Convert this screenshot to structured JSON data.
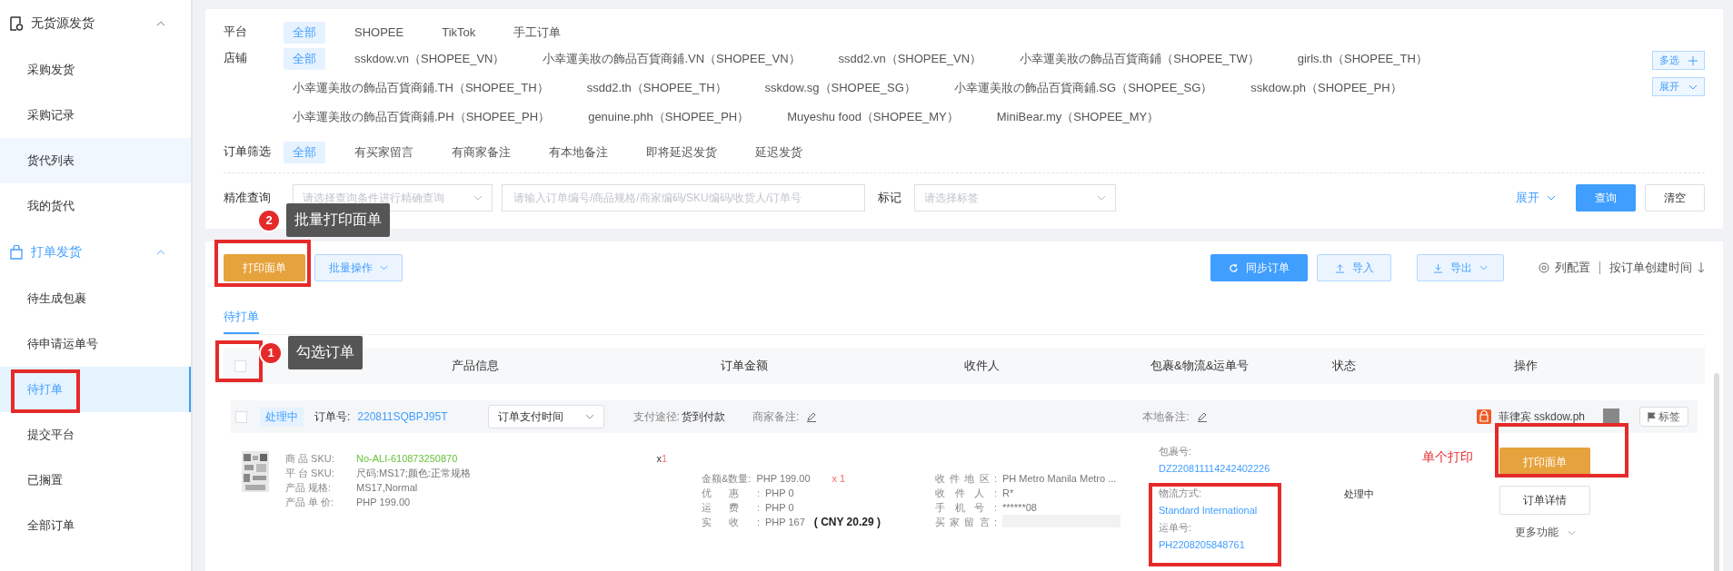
{
  "sidebar": {
    "groups": [
      {
        "label": "无货源发货",
        "kind": "doc",
        "active": false,
        "expanded": true,
        "items": [
          {
            "label": "采购发货",
            "selected": false,
            "hovered": false
          },
          {
            "label": "采购记录",
            "selected": false,
            "hovered": false
          },
          {
            "label": "货代列表",
            "selected": false,
            "hovered": true
          },
          {
            "label": "我的货代",
            "selected": false,
            "hovered": false
          }
        ]
      },
      {
        "label": "打单发货",
        "kind": "bag",
        "active": true,
        "expanded": true,
        "items": [
          {
            "label": "待生成包裹",
            "selected": false,
            "hovered": false
          },
          {
            "label": "待申请运单号",
            "selected": false,
            "hovered": false
          },
          {
            "label": "待打单",
            "selected": true,
            "hovered": false
          },
          {
            "label": "提交平台",
            "selected": false,
            "hovered": false
          },
          {
            "label": "已搁置",
            "selected": false,
            "hovered": false
          },
          {
            "label": "全部订单",
            "selected": false,
            "hovered": false
          }
        ]
      }
    ]
  },
  "filters": {
    "platform": {
      "label": "平台",
      "options": [
        {
          "label": "全部",
          "selected": true
        },
        {
          "label": "SHOPEE",
          "selected": false
        },
        {
          "label": "TikTok",
          "selected": false
        },
        {
          "label": "手工订单",
          "selected": false
        }
      ]
    },
    "store": {
      "label": "店铺",
      "rows": [
        {
          "options": [
            {
              "label": "全部",
              "selected": true
            },
            {
              "label": "sskdow.vn（SHOPEE_VN）",
              "selected": false
            },
            {
              "label": "小幸運美妝の飾品百貨商鋪.VN（SHOPEE_VN）",
              "selected": false
            },
            {
              "label": "ssdd2.vn（SHOPEE_VN）",
              "selected": false
            },
            {
              "label": "小幸運美妝の飾品百貨商鋪（SHOPEE_TW）",
              "selected": false
            },
            {
              "label": "girls.th（SHOPEE_TH）",
              "selected": false
            }
          ]
        },
        {
          "options": [
            {
              "label": "小幸運美妝の飾品百貨商鋪.TH（SHOPEE_TH）",
              "selected": false
            },
            {
              "label": "ssdd2.th（SHOPEE_TH）",
              "selected": false
            },
            {
              "label": "sskdow.sg（SHOPEE_SG）",
              "selected": false
            },
            {
              "label": "小幸運美妝の飾品百貨商鋪.SG（SHOPEE_SG）",
              "selected": false
            },
            {
              "label": "sskdow.ph（SHOPEE_PH）",
              "selected": false
            }
          ]
        },
        {
          "options": [
            {
              "label": "小幸運美妝の飾品百貨商鋪.PH（SHOPEE_PH）",
              "selected": false
            },
            {
              "label": "genuine.phh（SHOPEE_PH）",
              "selected": false
            },
            {
              "label": "Muyeshu food（SHOPEE_MY）",
              "selected": false
            },
            {
              "label": "MiniBear.my（SHOPEE_MY）",
              "selected": false
            }
          ]
        }
      ],
      "multi_button": "多选",
      "expand_button": "展开"
    },
    "order_filter": {
      "label": "订单筛选",
      "options": [
        {
          "label": "全部",
          "selected": true
        },
        {
          "label": "有买家留言",
          "selected": false
        },
        {
          "label": "有商家备注",
          "selected": false
        },
        {
          "label": "有本地备注",
          "selected": false
        },
        {
          "label": "即将延迟发货",
          "selected": false
        },
        {
          "label": "延迟发货",
          "selected": false
        }
      ]
    }
  },
  "search": {
    "label": "精准查询",
    "condition_placeholder": "请选择查询条件进行精确查询",
    "keyword_placeholder": "请输入订单编号/商品规格/商家编码/SKU编码/收货人/订单号",
    "tag_label": "标记",
    "tag_placeholder": "请选择标签",
    "expand": "展开",
    "query_button": "查询",
    "clear_button": "清空"
  },
  "toolbar": {
    "print_button": "打印面单",
    "batch_button": "批量操作",
    "sync_button": "同步订单",
    "import_button": "导入",
    "export_button": "导出",
    "column_config": "列配置",
    "sort": "按订单创建时间"
  },
  "tabs": [
    {
      "label": "待打单",
      "selected": true
    }
  ],
  "table": {
    "select_all_checked": false,
    "columns": [
      "产品信息",
      "订单金额",
      "收件人",
      "包裹&物流&运单号",
      "状态",
      "操作"
    ],
    "orders": [
      {
        "checked": false,
        "status_badge": "处理中",
        "order_no_label": "订单号:",
        "order_no": "220811SQBPJ95T",
        "time_select": "订单支付时间",
        "payment_label": "支付途径:",
        "payment": "货到付款",
        "merchant_note_label": "商家备注:",
        "local_note_label": "本地备注:",
        "shop_country": "菲律宾",
        "shop_name": "sskdow.ph",
        "tag_button": "标签",
        "product": {
          "fields": [
            {
              "label": "商 品 SKU:",
              "value": "No-ALI-610873250870",
              "kind": "sku"
            },
            {
              "label": "平 台 SKU:",
              "value": "尺码:MS17;颜色:正常规格",
              "kind": "text"
            },
            {
              "label": "产品 规格:",
              "value": "MS17,Normal",
              "kind": "text"
            },
            {
              "label": "产品 单 价:",
              "value": "PHP 199.00",
              "kind": "text"
            }
          ],
          "qty_sign": "x",
          "qty": "1"
        },
        "amounts": [
          {
            "label": "金额&数量:",
            "value": "PHP 199.00",
            "extra": "x 1",
            "kind": "qty"
          },
          {
            "label": "优惠:",
            "value": "PHP 0",
            "kind": "plain"
          },
          {
            "label": "运费:",
            "value": "PHP 0",
            "kind": "plain"
          },
          {
            "label": "实收:",
            "value": "PHP 167",
            "extra": "( CNY  20.29 )",
            "kind": "converted"
          }
        ],
        "recipient": [
          {
            "label": "收件地区:",
            "value": "PH Metro Manila Metro ..."
          },
          {
            "label": "收件人:",
            "value": "R*"
          },
          {
            "label": "手机号:",
            "value": "******08"
          },
          {
            "label": "买家留言:"
          }
        ],
        "package": {
          "package_no_label": "包裹号:",
          "package_no": "DZ220811114242402226",
          "logistics_label": "物流方式:",
          "logistics": "Standard International",
          "tracking_label": "运单号:",
          "tracking": "PH2208205848761"
        },
        "status": "处理中",
        "actions": {
          "print": "打印面单",
          "detail": "订单详情",
          "more": "更多功能"
        }
      }
    ]
  },
  "annotations": {
    "steps": [
      {
        "number": "2",
        "text": "批量打印面单"
      },
      {
        "number": "1",
        "text": "勾选订单"
      }
    ],
    "note": "单个打印"
  }
}
